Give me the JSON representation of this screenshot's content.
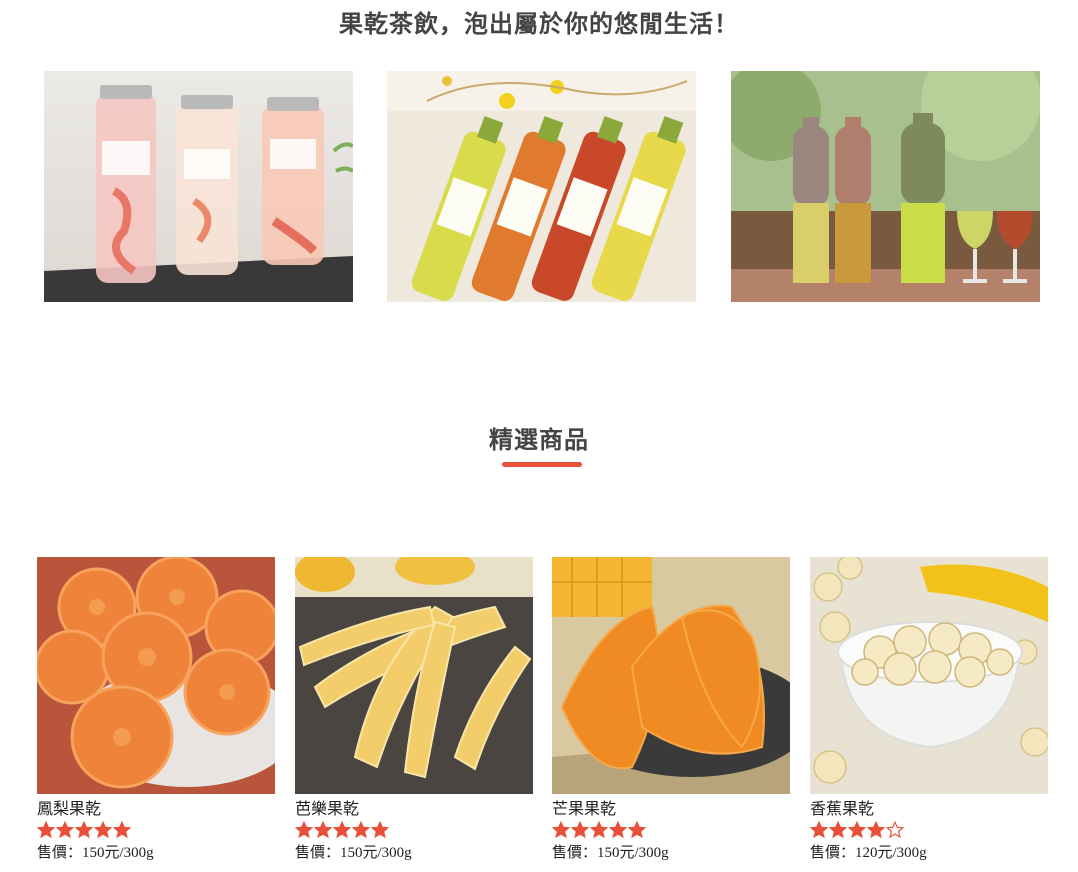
{
  "hero": {
    "title": "果乾茶飲，泡出屬於你的悠閒生活！",
    "photos": [
      {
        "icon": "pink-flower-tea-bottles-photo"
      },
      {
        "icon": "fruit-tea-bottles-photo"
      },
      {
        "icon": "cold-brew-tea-bottles-photo"
      }
    ]
  },
  "featured": {
    "title": "精選商品",
    "accent_color": "#e8503a"
  },
  "products": [
    {
      "name": "鳳梨果乾",
      "rating": 5,
      "max_rating": 5,
      "price": "售價：150元/300g",
      "icon": "dried-pineapple-photo"
    },
    {
      "name": "芭樂果乾",
      "rating": 5,
      "max_rating": 5,
      "price": "售價：150元/300g",
      "icon": "dried-guava-photo"
    },
    {
      "name": "芒果果乾",
      "rating": 5,
      "max_rating": 5,
      "price": "售價：150元/300g",
      "icon": "dried-mango-photo"
    },
    {
      "name": "香蕉果乾",
      "rating": 4,
      "max_rating": 5,
      "price": "售價：120元/300g",
      "icon": "dried-banana-photo"
    }
  ],
  "colors": {
    "star": "#e8503a",
    "text": "#222222"
  }
}
